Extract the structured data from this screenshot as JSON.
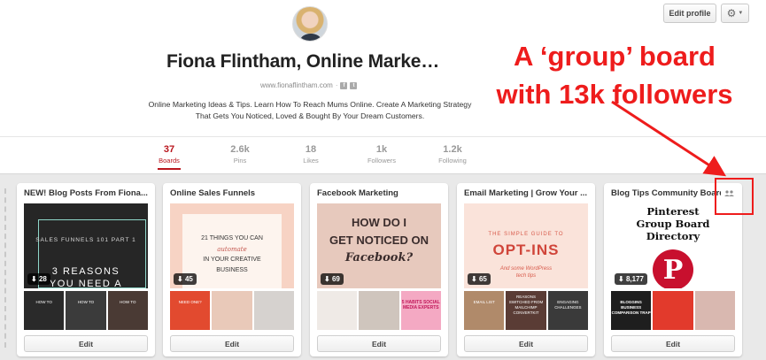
{
  "header": {
    "edit_profile_label": "Edit profile",
    "settings_icon": "gear-icon",
    "name": "Fiona Flintham, Online Marke…",
    "website": "www.fionaflintham.com",
    "social_icons": [
      "facebook-icon",
      "twitter-icon"
    ],
    "bio_line1": "Online Marketing Ideas & Tips. Learn How To Reach Mums Online. Create A Marketing Strategy",
    "bio_line2": "That Gets You Noticed, Loved & Bought By Your Dream Customers."
  },
  "stats": [
    {
      "num": "37",
      "label": "Boards",
      "active": true
    },
    {
      "num": "2.6k",
      "label": "Pins"
    },
    {
      "num": "18",
      "label": "Likes"
    },
    {
      "num": "1k",
      "label": "Followers"
    },
    {
      "num": "1.2k",
      "label": "Following"
    }
  ],
  "annotation": {
    "line1": "A ‘group’ board",
    "line2": "with 13k followers",
    "color": "#ee1c1c"
  },
  "colors": {
    "accent_red": "#b9151d",
    "background_boards": "#e9e9e9"
  },
  "boards": [
    {
      "title": "NEW! Blog Posts From Fiona...",
      "pins": "28",
      "cover_text": [
        "SALES FUNNELS 101 PART 1",
        "3 REASONS",
        "YOU NEED A"
      ],
      "thumb_text": [
        "HOW TO",
        "HOW TO",
        "HOW TO"
      ],
      "edit": "Edit"
    },
    {
      "title": "Online Sales Funnels",
      "pins": "45",
      "cover_text": [
        "21 THINGS YOU CAN",
        "automate",
        "IN YOUR CREATIVE",
        "BUSINESS"
      ],
      "thumb_text": [
        "NEED ONE?",
        "",
        ""
      ],
      "edit": "Edit"
    },
    {
      "title": "Facebook Marketing",
      "pins": "69",
      "cover_text": [
        "HOW DO I",
        "GET NOTICED ON",
        "Facebook?"
      ],
      "thumb_text": [
        "",
        "",
        "5 HABITS SOCIAL MEDIA EXPERTS"
      ],
      "edit": "Edit"
    },
    {
      "title": "Email Marketing | Grow Your ...",
      "pins": "65",
      "cover_text": [
        "THE SIMPLE GUIDE TO",
        "OPT-INS",
        "And some WordPress",
        "tech tips"
      ],
      "thumb_text": [
        "EMAIL LIST",
        "REASONS SWITCHED FROM MAILCHIMP CONVERTKIT",
        "ENGAGING CHALLENGES"
      ],
      "edit": "Edit"
    },
    {
      "title": "Blog Tips Community Board",
      "pins": "8,177",
      "cover_text": [
        "Pinterest",
        "Group Board",
        "Directory"
      ],
      "thumb_text": [
        "BLOGGING BUSINESS COMPARISON TRAP",
        "",
        ""
      ],
      "edit": "Edit",
      "group_icon": "group-people-icon"
    }
  ]
}
